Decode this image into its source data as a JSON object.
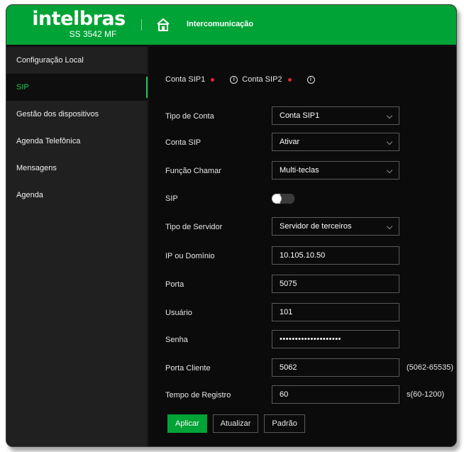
{
  "header": {
    "brand": "intelbras",
    "model": "SS 3542 MF",
    "icon": "home-icon",
    "title": "Intercomunicação",
    "accent": "#00a335"
  },
  "sidebar": {
    "items": [
      {
        "label": "Configuração Local",
        "active": false
      },
      {
        "label": "SIP",
        "active": true
      },
      {
        "label": "Gestão dos dispositivos",
        "active": false
      },
      {
        "label": "Agenda Telefônica",
        "active": false
      },
      {
        "label": "Mensagens",
        "active": false
      },
      {
        "label": "Agenda",
        "active": false
      }
    ]
  },
  "sip_tabs": [
    {
      "label": "Conta SIP1",
      "status_color": "#e0233a",
      "icon": "info-icon"
    },
    {
      "label": "Conta SIP2",
      "status_color": "#e0233a",
      "icon": "info-icon"
    }
  ],
  "form": {
    "tipo_conta": {
      "label": "Tipo de Conta",
      "value": "Conta SIP1"
    },
    "conta_sip": {
      "label": "Conta SIP",
      "value": "Ativar"
    },
    "funcao_chamar": {
      "label": "Função Chamar",
      "value": "Multi-teclas"
    },
    "sip": {
      "label": "SIP",
      "enabled": false
    },
    "tipo_servidor": {
      "label": "Tipo de Servidor",
      "value": "Servidor de terceiros"
    },
    "ip_dominio": {
      "label": "IP ou Domínio",
      "value": "10.105.10.50"
    },
    "porta": {
      "label": "Porta",
      "value": "5075"
    },
    "usuario": {
      "label": "Usuário",
      "value": "101"
    },
    "senha": {
      "label": "Senha",
      "value": "••••••••••••••••••••"
    },
    "porta_cliente": {
      "label": "Porta Cliente",
      "value": "5062",
      "hint": "(5062-65535)"
    },
    "tempo_registro": {
      "label": "Tempo de Registro",
      "value": "60",
      "hint": "s(60-1200)"
    }
  },
  "buttons": {
    "apply": "Aplicar",
    "refresh": "Atualizar",
    "default": "Padrão"
  }
}
